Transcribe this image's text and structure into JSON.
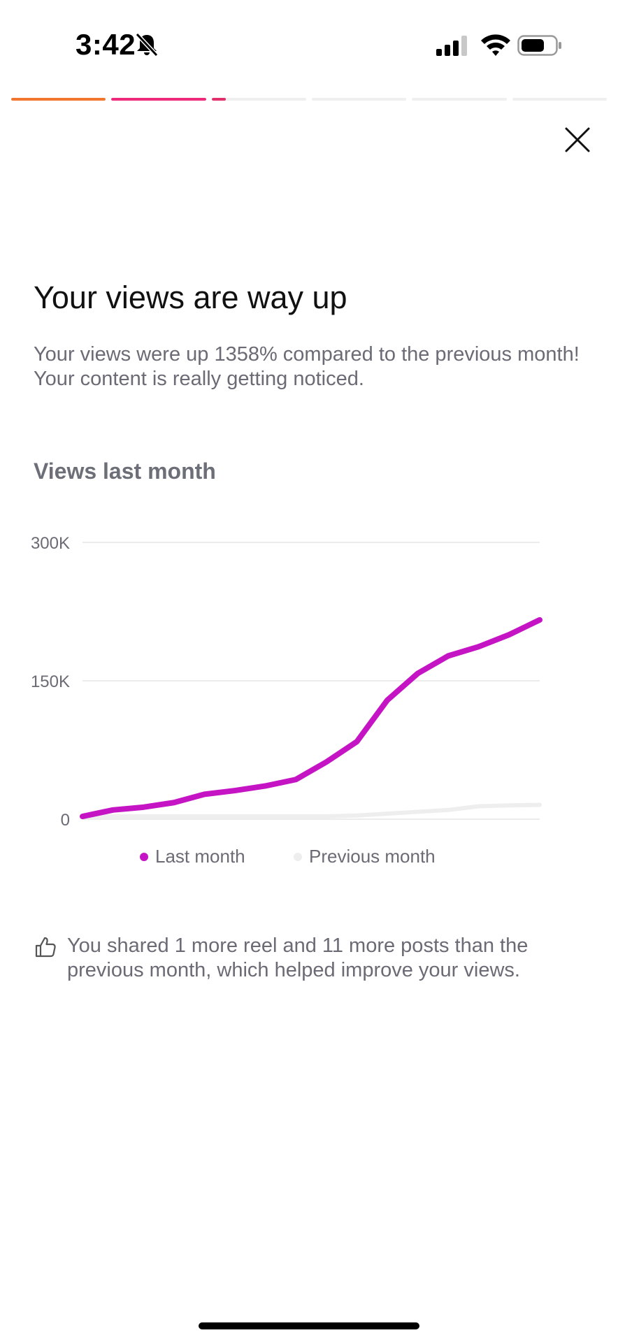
{
  "status_bar": {
    "time": "3:42",
    "icons": [
      "bell-slash-icon",
      "cellular-signal-icon",
      "wifi-icon",
      "battery-icon"
    ]
  },
  "story_progress": {
    "segments": [
      {
        "fill": 1.0,
        "color": "#f2762e"
      },
      {
        "fill": 1.0,
        "color": "#ee2a7b"
      },
      {
        "fill": 0.15,
        "color": "#e1306c"
      },
      {
        "fill": 0,
        "color": "#efefef"
      },
      {
        "fill": 0,
        "color": "#efefef"
      },
      {
        "fill": 0,
        "color": "#efefef"
      }
    ]
  },
  "header": {
    "title": "Your views are way up",
    "description": "Your views were up 1358% compared to the previous month! Your content is really getting noticed."
  },
  "chart_section": {
    "title": "Views last month"
  },
  "chart_data": {
    "type": "line",
    "title": "Views last month",
    "xlabel": "",
    "ylabel": "",
    "ylim": [
      0,
      300000
    ],
    "y_ticks": [
      "300K",
      "150K",
      "0"
    ],
    "y_tick_values": [
      300000,
      150000,
      0
    ],
    "grid": true,
    "legend": "bottom",
    "x": [
      1,
      2,
      3,
      4,
      5,
      6,
      7,
      8,
      9,
      10,
      11,
      12,
      13,
      14,
      15,
      16
    ],
    "series": [
      {
        "name": "Last month",
        "color": "#c514c4",
        "values": [
          3000,
          10000,
          13000,
          18000,
          27000,
          31000,
          36000,
          43000,
          62000,
          84000,
          129000,
          158000,
          177000,
          187000,
          200000,
          216000
        ]
      },
      {
        "name": "Previous month",
        "color": "#eeeeee",
        "values": [
          3000,
          3000,
          3000,
          3000,
          3000,
          3000,
          3000,
          3000,
          3000,
          4000,
          6000,
          8000,
          10000,
          14000,
          15000,
          15500
        ]
      }
    ]
  },
  "tip": {
    "icon": "thumbs-up-icon",
    "text": "You shared 1 more reel and 11 more posts than the previous month, which helped improve your views."
  },
  "colors": {
    "accent": "#c514c4",
    "secondary_text": "#6b6b75",
    "grid": "#e6e6e6"
  }
}
